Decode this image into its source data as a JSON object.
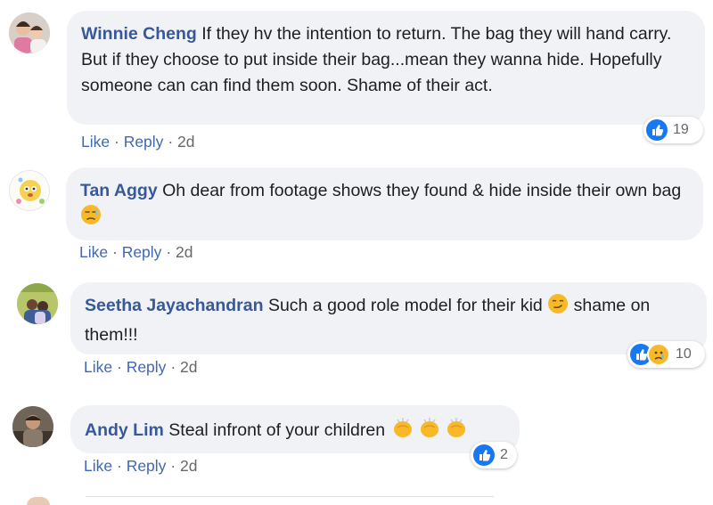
{
  "comments": [
    {
      "author": "Winnie Cheng",
      "text": "If they hv the intention to return. The bag they will hand carry. But if they choose to put inside their bag...mean they wanna hide. Hopefully someone can can find them soon. Shame of their act.",
      "like": "Like",
      "reply": "Reply",
      "sep": "·",
      "time": "2d",
      "reaction_count": "19",
      "reaction_icons": [
        "like-icon"
      ]
    },
    {
      "author": "Tan Aggy",
      "text": "Oh dear from footage shows they found & hide inside their own bag",
      "like": "Like",
      "reply": "Reply",
      "sep": "·",
      "time": "2d",
      "emoji": "unamused-face-emoji"
    },
    {
      "author": "Seetha Jayachandran",
      "text_before": "Such a good role model for their kid",
      "text_after": "shame on them!!!",
      "like": "Like",
      "reply": "Reply",
      "sep": "·",
      "time": "2d",
      "emoji": "smirking-face-emoji",
      "reaction_count": "10",
      "reaction_icons": [
        "like-icon",
        "sad-icon"
      ]
    },
    {
      "author": "Andy Lim",
      "text": "Steal infront of your children",
      "like": "Like",
      "reply": "Reply",
      "sep": "·",
      "time": "2d",
      "emoji": "clapping-hands-emoji",
      "reaction_count": "2",
      "reaction_icons": [
        "like-icon"
      ]
    }
  ],
  "colors": {
    "author": "#385898",
    "bubble": "#f0f2f5",
    "action_link": "#4267b2",
    "like_blue": "#1877f2",
    "emoji_yellow": "#f7b928"
  }
}
